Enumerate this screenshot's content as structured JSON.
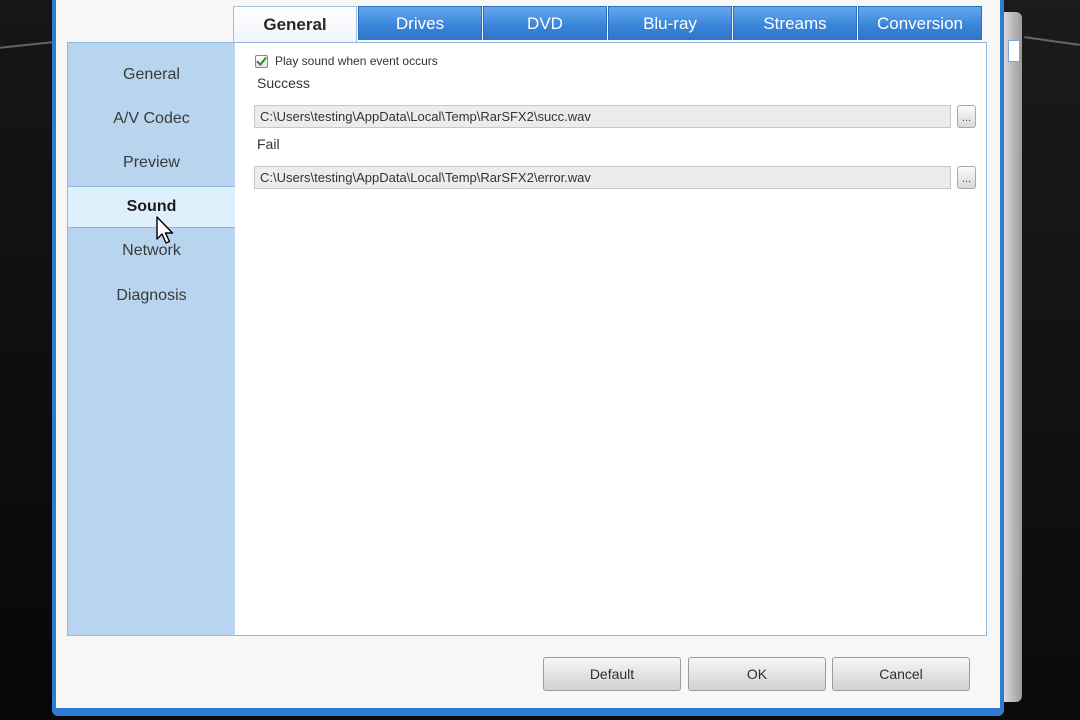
{
  "tabs": [
    {
      "label": "General",
      "active": true
    },
    {
      "label": "Drives",
      "active": false
    },
    {
      "label": "DVD",
      "active": false
    },
    {
      "label": "Blu-ray",
      "active": false
    },
    {
      "label": "Streams",
      "active": false
    },
    {
      "label": "Conversion",
      "active": false
    }
  ],
  "sidebar": {
    "items": [
      {
        "label": "General"
      },
      {
        "label": "A/V Codec"
      },
      {
        "label": "Preview"
      },
      {
        "label": "Sound",
        "active": true
      },
      {
        "label": "Network"
      },
      {
        "label": "Diagnosis"
      }
    ]
  },
  "sound": {
    "play_sound_label": "Play sound when event occurs",
    "play_sound_checked": true,
    "success_label": "Success",
    "success_path": "C:\\Users\\testing\\AppData\\Local\\Temp\\RarSFX2\\succ.wav",
    "fail_label": "Fail",
    "fail_path": "C:\\Users\\testing\\AppData\\Local\\Temp\\RarSFX2\\error.wav",
    "browse_label": "..."
  },
  "buttons": {
    "default_label": "Default",
    "ok_label": "OK",
    "cancel_label": "Cancel"
  },
  "colors": {
    "accent": "#2e7bd1",
    "sidebar_bg": "#b9d4ee",
    "sidebar_active_bg": "#dff0fd",
    "checkmark": "#2e8b2e"
  },
  "icons": {
    "checkbox": "checkmark-icon",
    "pointer": "mouse-cursor-icon"
  }
}
